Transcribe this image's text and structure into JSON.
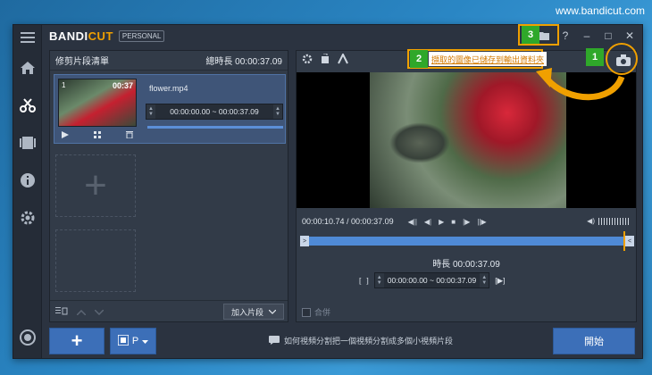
{
  "site_url": "www.bandicut.com",
  "app": {
    "logo_part1": "BANDI",
    "logo_part2": "CUT",
    "edition": "PERSONAL"
  },
  "window_controls": {
    "help": "?",
    "minimize": "–",
    "maximize": "□",
    "close": "✕"
  },
  "clip_panel": {
    "title": "修剪片段清單",
    "total_label": "總時長 00:00:37.09",
    "clip": {
      "index": "1",
      "duration": "00:37",
      "file_name": "flower.mp4",
      "range": "00:00:00.00 ~ 00:00:37.09"
    },
    "add_segment_label": "加入片段"
  },
  "preview": {
    "time_display": "00:00:10.74 / 00:00:37.09",
    "total_duration": "時長 00:00:37.09",
    "segment_range": "00:00:00.00 ~ 00:00:37.09",
    "merge_label": "合併"
  },
  "bottom": {
    "add_label": "+",
    "mode_label": "P",
    "help_text": "如何視頻分割把一個視頻分割成多個小視頻片段",
    "start_label": "開始"
  },
  "annotations": {
    "badge1": "1",
    "badge2": "2",
    "badge3": "3",
    "tip_text": "擷取的圖像已儲存到輸出資料夾"
  }
}
